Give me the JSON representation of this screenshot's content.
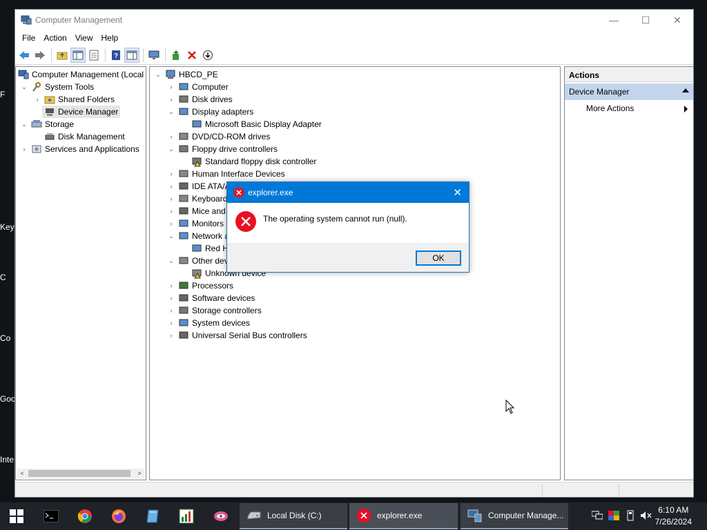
{
  "desktop": {
    "labels": [
      "F",
      "Key",
      "C",
      "Co",
      "Goo",
      "Inte"
    ]
  },
  "window": {
    "title": "Computer Management",
    "controls": {
      "minimize": "—",
      "maximize": "☐",
      "close": "✕"
    }
  },
  "menu": [
    "File",
    "Action",
    "View",
    "Help"
  ],
  "toolbar_icons": [
    "back-arrow-icon",
    "forward-arrow-icon",
    "up-folder-icon",
    "show-hide-console-tree-icon",
    "properties-icon",
    "help-icon",
    "show-action-pane-icon",
    "monitor-icon",
    "update-driver-icon",
    "uninstall-device-icon",
    "disable-device-icon"
  ],
  "left_tree": {
    "items": [
      {
        "label": "Computer Management (Local",
        "exp": "",
        "indent": 0
      },
      {
        "label": "System Tools",
        "exp": "⌄",
        "indent": 1
      },
      {
        "label": "Shared Folders",
        "exp": "›",
        "indent": 2
      },
      {
        "label": "Device Manager",
        "exp": "",
        "indent": 2,
        "selected": true
      },
      {
        "label": "Storage",
        "exp": "⌄",
        "indent": 1
      },
      {
        "label": "Disk Management",
        "exp": "",
        "indent": 2
      },
      {
        "label": "Services and Applications",
        "exp": "›",
        "indent": 1
      }
    ],
    "scroll_left": "<",
    "scroll_right": ">"
  },
  "device_tree": {
    "root": "HBCD_PE",
    "items": [
      {
        "label": "Computer",
        "exp": "›",
        "indent": 1
      },
      {
        "label": "Disk drives",
        "exp": "›",
        "indent": 1
      },
      {
        "label": "Display adapters",
        "exp": "⌄",
        "indent": 1
      },
      {
        "label": "Microsoft Basic Display Adapter",
        "exp": "",
        "indent": 2
      },
      {
        "label": "DVD/CD-ROM drives",
        "exp": "›",
        "indent": 1
      },
      {
        "label": "Floppy drive controllers",
        "exp": "⌄",
        "indent": 1
      },
      {
        "label": "Standard floppy disk controller",
        "exp": "",
        "indent": 2,
        "warn": true
      },
      {
        "label": "Human Interface Devices",
        "exp": "›",
        "indent": 1
      },
      {
        "label": "IDE ATA/A",
        "exp": "›",
        "indent": 1
      },
      {
        "label": "Keyboard",
        "exp": "›",
        "indent": 1
      },
      {
        "label": "Mice and",
        "exp": "›",
        "indent": 1
      },
      {
        "label": "Monitors",
        "exp": "›",
        "indent": 1
      },
      {
        "label": "Network a",
        "exp": "⌄",
        "indent": 1
      },
      {
        "label": "Red H",
        "exp": "",
        "indent": 2
      },
      {
        "label": "Other dev",
        "exp": "⌄",
        "indent": 1
      },
      {
        "label": "Unknown device",
        "exp": "",
        "indent": 2,
        "warn": true
      },
      {
        "label": "Processors",
        "exp": "›",
        "indent": 1
      },
      {
        "label": "Software devices",
        "exp": "›",
        "indent": 1
      },
      {
        "label": "Storage controllers",
        "exp": "›",
        "indent": 1
      },
      {
        "label": "System devices",
        "exp": "›",
        "indent": 1
      },
      {
        "label": "Universal Serial Bus controllers",
        "exp": "›",
        "indent": 1
      }
    ]
  },
  "actions": {
    "title": "Actions",
    "section": "Device Manager",
    "items": [
      "More Actions"
    ]
  },
  "dialog": {
    "title": "explorer.exe",
    "message": "The operating system cannot run (null).",
    "ok_label": "OK",
    "close": "✕"
  },
  "taskbar": {
    "buttons": [
      {
        "label": "Local Disk (C:)",
        "icon": "drive-icon"
      },
      {
        "label": "explorer.exe",
        "icon": "error-icon"
      },
      {
        "label": "Computer Manage...",
        "icon": "computer-management-icon"
      }
    ],
    "time": "6:10 AM",
    "date": "7/26/2024"
  },
  "colors": {
    "accent": "#0078d7",
    "error_red": "#e81123",
    "selection": "#e5e5e5",
    "actions_section": "#c3d5ec",
    "taskbar": "#1f2228"
  }
}
